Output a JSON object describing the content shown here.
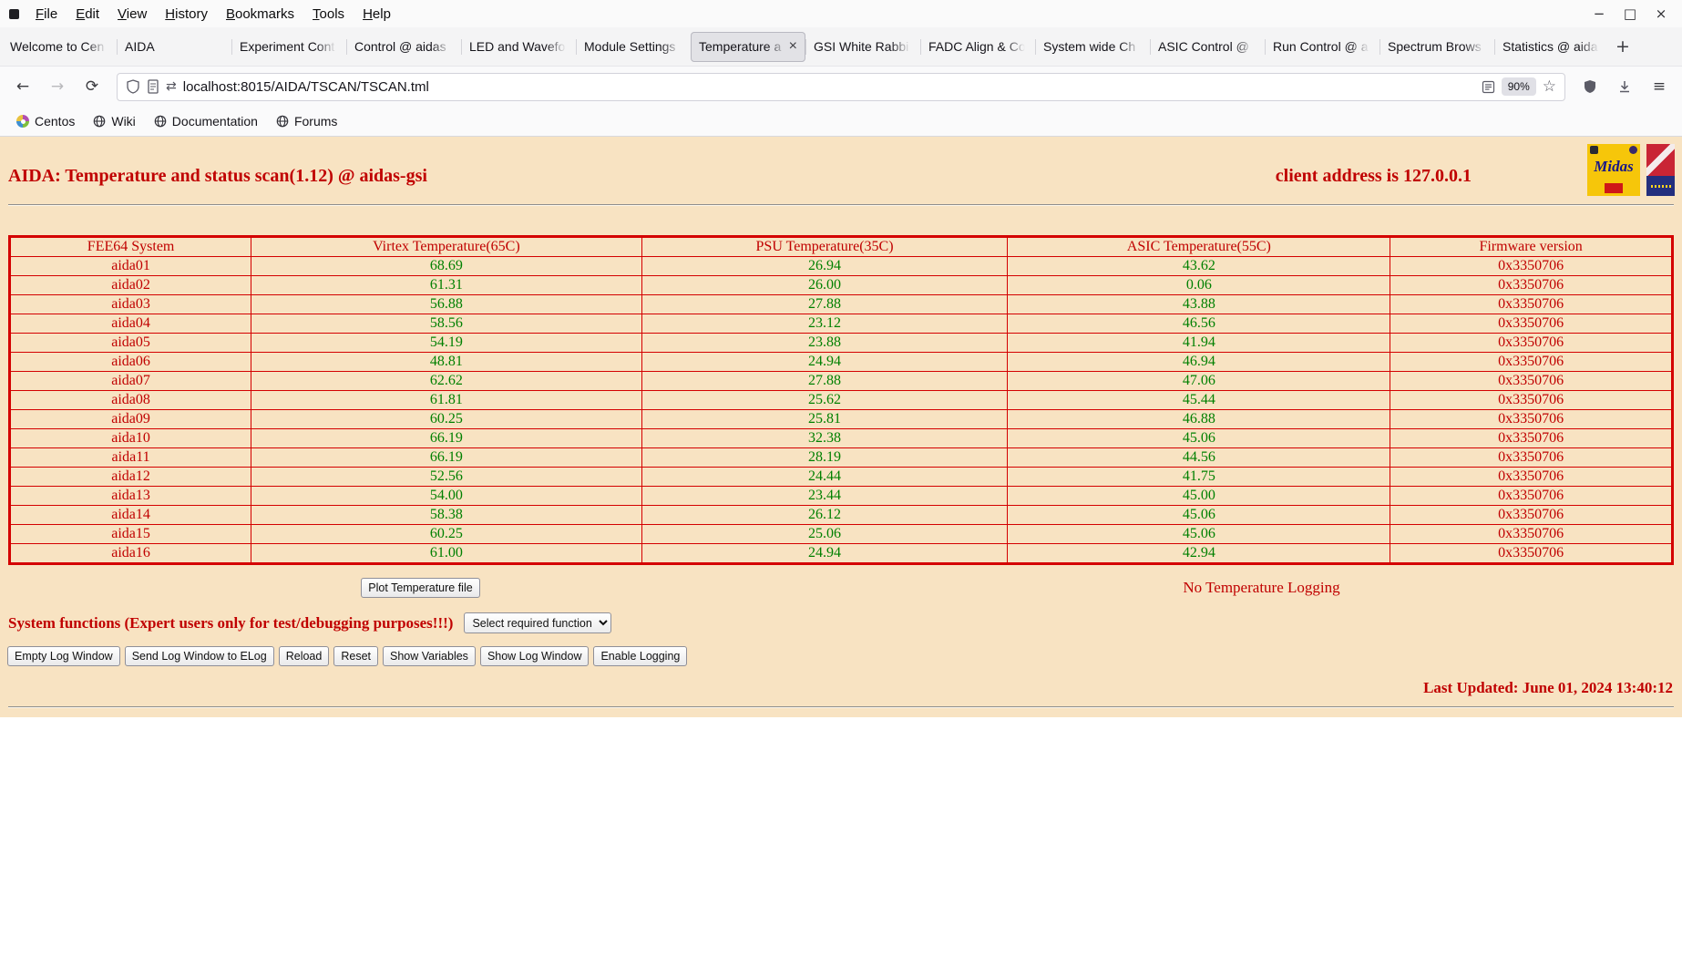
{
  "window": {
    "menu_items": [
      "File",
      "Edit",
      "View",
      "History",
      "Bookmarks",
      "Tools",
      "Help"
    ],
    "controls": {
      "minimize": "−",
      "maximize": "□",
      "close": "×"
    }
  },
  "glyphs": {
    "back": "←",
    "forward": "→",
    "reload": "⟳",
    "exchange": "⇄",
    "star": "☆",
    "hamburger": "≡",
    "new_tab": "+"
  },
  "tabs": [
    {
      "label": "Welcome to Cen",
      "active": false
    },
    {
      "label": "AIDA",
      "active": false
    },
    {
      "label": "Experiment Cont",
      "active": false
    },
    {
      "label": "Control @ aidas",
      "active": false
    },
    {
      "label": "LED and Wavefo",
      "active": false
    },
    {
      "label": "Module Settings",
      "active": false
    },
    {
      "label": "Temperature a",
      "active": true
    },
    {
      "label": "GSI White Rabbi",
      "active": false
    },
    {
      "label": "FADC Align & Co",
      "active": false
    },
    {
      "label": "System wide Ch",
      "active": false
    },
    {
      "label": "ASIC Control @",
      "active": false
    },
    {
      "label": "Run Control @ a",
      "active": false
    },
    {
      "label": "Spectrum Brows",
      "active": false
    },
    {
      "label": "Statistics @ aida",
      "active": false
    }
  ],
  "navbar": {
    "url": "localhost:8015/AIDA/TSCAN/TSCAN.tml",
    "zoom_level": "90%"
  },
  "bookmarks": [
    {
      "label": "Centos",
      "icon": "centos-logo"
    },
    {
      "label": "Wiki",
      "icon": "globe"
    },
    {
      "label": "Documentation",
      "icon": "globe"
    },
    {
      "label": "Forums",
      "icon": "globe"
    }
  ],
  "page": {
    "title": "AIDA: Temperature and status scan(1.12) @ aidas-gsi",
    "client_address": "client address is 127.0.0.1",
    "logo_text": "Midas",
    "table": {
      "headers": [
        "FEE64 System",
        "Virtex Temperature(65C)",
        "PSU Temperature(35C)",
        "ASIC Temperature(55C)",
        "Firmware version"
      ],
      "rows": [
        [
          "aida01",
          "68.69",
          "26.94",
          "43.62",
          "0x3350706"
        ],
        [
          "aida02",
          "61.31",
          "26.00",
          "0.06",
          "0x3350706"
        ],
        [
          "aida03",
          "56.88",
          "27.88",
          "43.88",
          "0x3350706"
        ],
        [
          "aida04",
          "58.56",
          "23.12",
          "46.56",
          "0x3350706"
        ],
        [
          "aida05",
          "54.19",
          "23.88",
          "41.94",
          "0x3350706"
        ],
        [
          "aida06",
          "48.81",
          "24.94",
          "46.94",
          "0x3350706"
        ],
        [
          "aida07",
          "62.62",
          "27.88",
          "47.06",
          "0x3350706"
        ],
        [
          "aida08",
          "61.81",
          "25.62",
          "45.44",
          "0x3350706"
        ],
        [
          "aida09",
          "60.25",
          "25.81",
          "46.88",
          "0x3350706"
        ],
        [
          "aida10",
          "66.19",
          "32.38",
          "45.06",
          "0x3350706"
        ],
        [
          "aida11",
          "66.19",
          "28.19",
          "44.56",
          "0x3350706"
        ],
        [
          "aida12",
          "52.56",
          "24.44",
          "41.75",
          "0x3350706"
        ],
        [
          "aida13",
          "54.00",
          "23.44",
          "45.00",
          "0x3350706"
        ],
        [
          "aida14",
          "58.38",
          "26.12",
          "45.06",
          "0x3350706"
        ],
        [
          "aida15",
          "60.25",
          "25.06",
          "45.06",
          "0x3350706"
        ],
        [
          "aida16",
          "61.00",
          "24.94",
          "42.94",
          "0x3350706"
        ]
      ]
    },
    "plot_button_label": "Plot Temperature file",
    "logging_status": "No Temperature Logging",
    "system_functions_label": "System functions (Expert users only for test/debugging purposes!!!)",
    "function_select_value": "Select required function",
    "action_buttons": [
      "Empty Log Window",
      "Send Log Window to ELog",
      "Reload",
      "Reset",
      "Show Variables",
      "Show Log Window",
      "Enable Logging"
    ],
    "last_updated": "Last Updated: June 01, 2024 13:40:12"
  },
  "colors": {
    "page_background": "#f8e3c2",
    "accent_red": "#c00000",
    "value_green": "#008000",
    "table_border_red": "#d40000"
  }
}
